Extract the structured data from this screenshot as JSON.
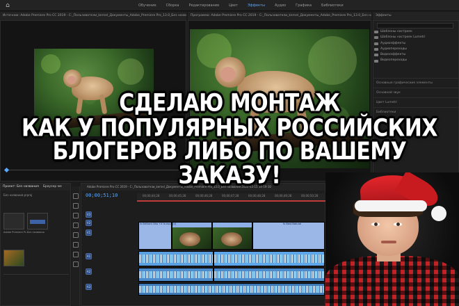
{
  "app": {
    "workspaces": [
      "Обучение",
      "Сборка",
      "Редактирование",
      "Цвет",
      "Эффекты",
      "Аудио",
      "Графика",
      "Библиотеки"
    ],
    "active_workspace": "Эффекты"
  },
  "source_panel": {
    "title": "Источник: Adobe Premiere Pro CC 2019 - C:_Пользователи_kernel_Документы_Adobe_Premiere Pro_13.0_Без названия 2020-03-15 14-19-10"
  },
  "program_panel": {
    "title": "Программа: Adobe Premiere Pro CC 2019 - C:_Пользователи_kernel_Документы_Adobe_Premiere Pro_13.0_Без названия 2020-03-15 14-19-10"
  },
  "effects_panel": {
    "title": "Эффекты",
    "items": [
      "Шаблоны настроек",
      "Шаблоны настроек Lumetri",
      "Аудиоэффекты",
      "Аудиопереходы",
      "Видеоэффекты",
      "Видеопереходы"
    ],
    "sections": [
      "Основные графические элементы",
      "Основной звук",
      "Цвет Lumetri",
      "Библиотеки"
    ]
  },
  "project_panel": {
    "tabs": [
      "Проект: Без названия",
      "Браузер ме"
    ],
    "file": "Без названия.prproj",
    "clips": [
      {
        "name": "Adobe Premiere Pr...",
        "dur": "5;00"
      },
      {
        "name": "Без названия",
        "dur": "13;14"
      },
      {
        "name": "",
        "dur": "10;13"
      }
    ]
  },
  "timeline": {
    "title": "Adobe Premiere Pro CC 2019 - C:_Пользователи_kernel_Документы_Adobe_Premiere Pro_13.0_Без названия 2020-03-15 14-19-10",
    "timecode": "00;00;51;10",
    "ruler": [
      "00;00;44;28",
      "00;00;45;28",
      "00;00;46;28",
      "00;00;47;28",
      "00;00;48;28",
      "00;00;49;28",
      "00;00;50;28"
    ],
    "tracks": [
      "V3",
      "V2",
      "V1",
      "A1",
      "A2",
      "A3"
    ],
    "clip_labels": [
      "fx Brilliant Ulta +X fx.mp4 [V]",
      "fx Best Natural"
    ]
  },
  "headline": {
    "line1": "СДЕЛАЮ МОНТАЖ",
    "line2": "КАК У ПОПУЛЯРНЫХ РОССИЙСКИХ",
    "line3": "БЛОГЕРОВ ЛИБО ПО ВАШЕМУ ЗАКАЗУ!"
  }
}
